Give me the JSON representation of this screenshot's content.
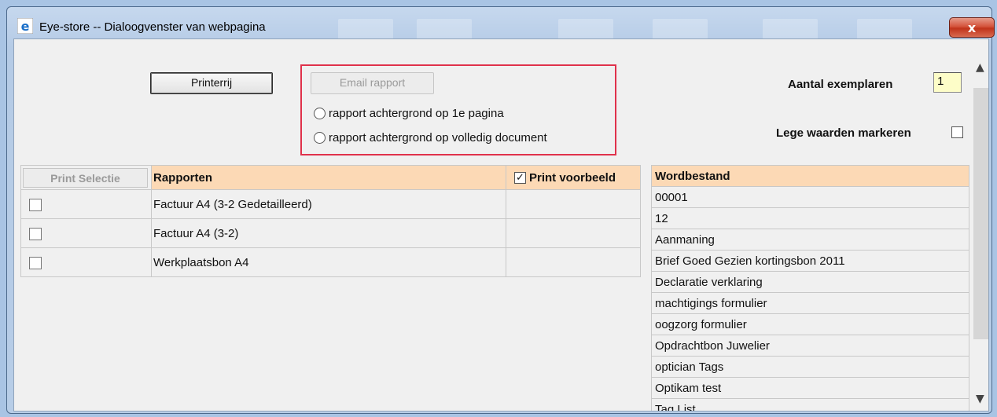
{
  "window": {
    "title": "Eye-store -- Dialoogvenster van webpagina",
    "close_label": "x"
  },
  "toolbar": {
    "printer_label": "Printerrij",
    "email_label": "Email rapport",
    "radio_first_page": "rapport achtergrond op 1e pagina",
    "radio_full_document": "rapport achtergrond op volledig document"
  },
  "settings": {
    "copies_label": "Aantal exemplaren",
    "copies_value": "1",
    "mark_empty_label": "Lege waarden markeren"
  },
  "reports": {
    "print_selection_label": "Print Selectie",
    "header": "Rapporten",
    "preview_label": "Print voorbeeld",
    "rows": [
      "Factuur A4 (3-2 Gedetailleerd)",
      "Factuur A4 (3-2)",
      "Werkplaatsbon A4"
    ]
  },
  "wordbestand": {
    "header": "Wordbestand",
    "items": [
      "00001",
      "12",
      "Aanmaning",
      "Brief Goed Gezien kortingsbon 2011",
      "Declaratie verklaring",
      "machtigings formulier",
      "oogzorg formulier",
      "Opdrachtbon Juwelier",
      "optician Tags",
      "Optikam test",
      "Tag List"
    ]
  },
  "colors": {
    "header_bg": "#fcd9b5",
    "highlight_border": "#e0314b",
    "copies_input_bg": "#fdfdc8"
  }
}
